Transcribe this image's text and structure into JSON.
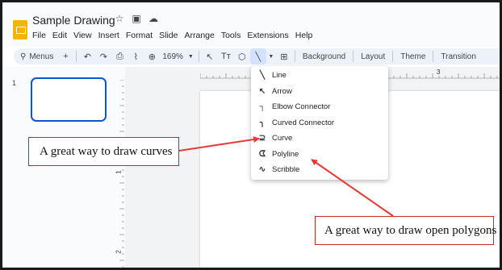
{
  "app": {
    "title": "Sample Drawing",
    "title_icons": [
      "star-icon",
      "move-to-folder-icon",
      "cloud-status-icon"
    ],
    "menu": [
      "File",
      "Edit",
      "View",
      "Insert",
      "Format",
      "Slide",
      "Arrange",
      "Tools",
      "Extensions",
      "Help"
    ]
  },
  "toolbar": {
    "menus_label": "Menus",
    "zoom": "169%",
    "items": [
      "Background",
      "Layout",
      "Theme",
      "Transition"
    ]
  },
  "filmstrip": {
    "slide_number": "1"
  },
  "rulers": {
    "horizontal_mark": "3",
    "vertical_marks": [
      "1",
      "2"
    ]
  },
  "line_menu": {
    "items": [
      {
        "label": "Line",
        "icon": "line-icon"
      },
      {
        "label": "Arrow",
        "icon": "arrow-icon"
      },
      {
        "label": "Elbow Connector",
        "icon": "elbow-connector-icon"
      },
      {
        "label": "Curved Connector",
        "icon": "curved-connector-icon"
      },
      {
        "label": "Curve",
        "icon": "curve-icon"
      },
      {
        "label": "Polyline",
        "icon": "polyline-icon"
      },
      {
        "label": "Scribble",
        "icon": "scribble-icon"
      }
    ]
  },
  "annotations": {
    "curves_note": "A great way to draw curves",
    "polygons_note": "A great way to draw open polygons",
    "arrow_color": "#e53935"
  },
  "colors": {
    "accent": "#0b57d0",
    "toolbar_bg": "#edf2fa",
    "app_icon": "#f4b400",
    "callout_border": "#c62828"
  }
}
